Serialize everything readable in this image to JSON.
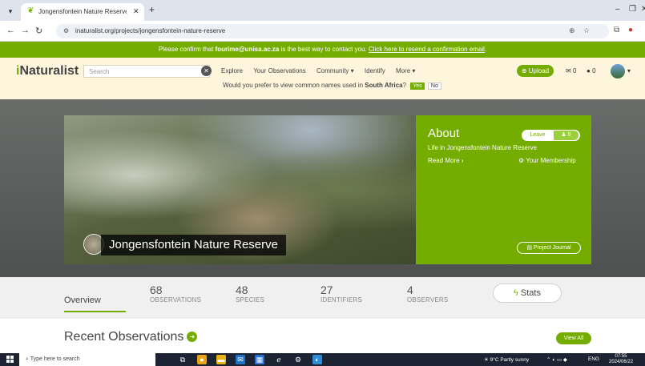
{
  "browser": {
    "tab_title": "Jongensfontein Nature Reserve",
    "url": "inaturalist.org/projects/jongensfontein-nature-reserve"
  },
  "confirm_bar": {
    "prefix": "Please confirm that ",
    "email": "fourime@unisa.ac.za",
    "middle": " is the best way to contact you. ",
    "link": "Click here to resend a confirmation email",
    "suffix": "."
  },
  "header": {
    "logo_i": "i",
    "logo_rest": "Naturalist",
    "search_placeholder": "Search",
    "nav": [
      "Explore",
      "Your Observations",
      "Community ▾",
      "Identify",
      "More ▾"
    ],
    "upload_label": "Upload",
    "messages_count": "0",
    "notifications_count": "0",
    "common_names_question_prefix": "Would you prefer to view common names used in ",
    "common_names_region": "South Africa",
    "common_names_question_suffix": "?",
    "yes_label": "Yes",
    "no_label": "No"
  },
  "hero": {
    "project_title": "Jongensfontein Nature Reserve",
    "about_title": "About",
    "leave_label": "Leave",
    "members_count": "5",
    "description": "Life in Jongensfontein Nature Reserve",
    "read_more": "Read More ›",
    "membership_label": "Your Membership",
    "journal_label": "Project Journal"
  },
  "stats": {
    "overview_label": "Overview",
    "items": [
      {
        "number": "68",
        "label": "OBSERVATIONS"
      },
      {
        "number": "48",
        "label": "SPECIES"
      },
      {
        "number": "27",
        "label": "IDENTIFIERS"
      },
      {
        "number": "4",
        "label": "OBSERVERS"
      }
    ],
    "stats_button_label": "Stats"
  },
  "recent": {
    "title": "Recent Observations",
    "view_all": "View All"
  },
  "taskbar": {
    "search_placeholder": "Type here to search",
    "weather": "9°C  Partly sunny",
    "language": "ENG",
    "time": "07:55",
    "date": "2024/06/22"
  },
  "colors": {
    "brand_green": "#74ac00",
    "header_bg": "#fdf6dc"
  }
}
